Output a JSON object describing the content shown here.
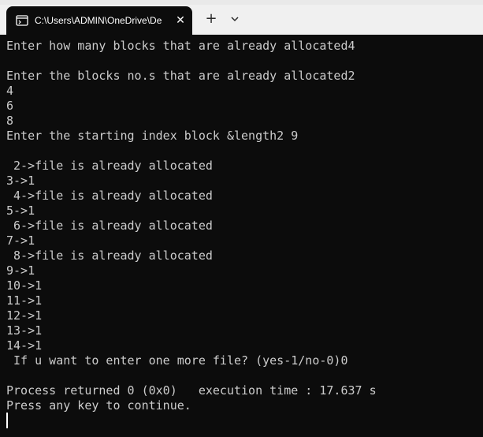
{
  "window": {
    "tab_title": "C:\\Users\\ADMIN\\OneDrive\\De",
    "close_glyph": "✕",
    "new_tab_glyph": "+",
    "icons": {
      "tab_icon": "terminal-app-icon",
      "dropdown_icon": "chevron-down-icon"
    }
  },
  "terminal": {
    "lines": [
      "Enter how many blocks that are already allocated4",
      "",
      "Enter the blocks no.s that are already allocated2",
      "4",
      "6",
      "8",
      "Enter the starting index block &length2 9",
      "",
      " 2->file is already allocated",
      "3->1",
      " 4->file is already allocated",
      "5->1",
      " 6->file is already allocated",
      "7->1",
      " 8->file is already allocated",
      "9->1",
      "10->1",
      "11->1",
      "12->1",
      "13->1",
      "14->1",
      " If u want to enter one more file? (yes-1/no-0)0",
      "",
      "Process returned 0 (0x0)   execution time : 17.637 s",
      "Press any key to continue."
    ]
  },
  "colors": {
    "terminal_bg": "#0c0c0c",
    "terminal_fg": "#cccccc",
    "titlebar_bg": "#f0f0f0"
  }
}
